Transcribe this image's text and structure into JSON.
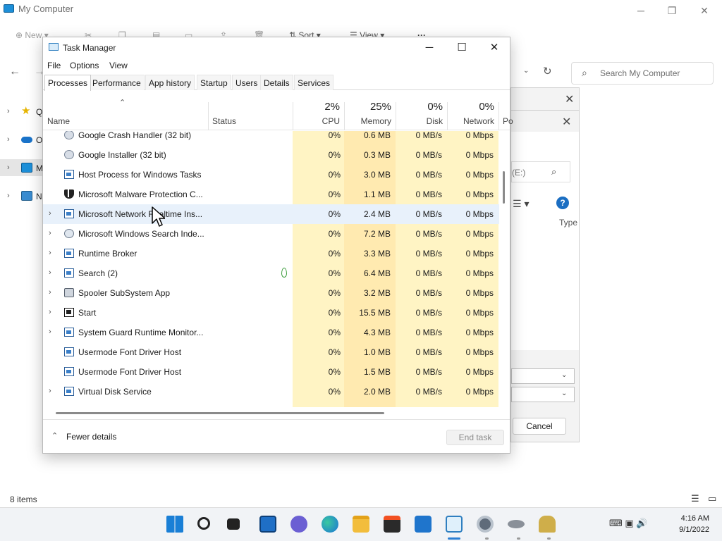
{
  "explorer": {
    "title": "My Computer",
    "toolbar": {
      "new": "New",
      "sort": "Sort",
      "view": "View",
      "more": "···"
    },
    "search_placeholder": "Search My Computer",
    "sidebar": [
      {
        "label": "Q",
        "icon": "star-icon"
      },
      {
        "label": "O",
        "icon": "cloud-icon"
      },
      {
        "label": "M",
        "icon": "monitor-icon"
      },
      {
        "label": "N",
        "icon": "network-icon"
      }
    ],
    "status": "8 items"
  },
  "dialog": {
    "path_text": "(E:)",
    "column_type": "Type",
    "cancel": "Cancel"
  },
  "taskmgr": {
    "title": "Task Manager",
    "menu": [
      "File",
      "Options",
      "View"
    ],
    "tabs": [
      "Processes",
      "Performance",
      "App history",
      "Startup",
      "Users",
      "Details",
      "Services"
    ],
    "active_tab": "Processes",
    "columns": {
      "name": "Name",
      "status": "Status",
      "cpu": {
        "pct": "2%",
        "label": "CPU"
      },
      "memory": {
        "pct": "25%",
        "label": "Memory"
      },
      "disk": {
        "pct": "0%",
        "label": "Disk"
      },
      "network": {
        "pct": "0%",
        "label": "Network"
      },
      "power": "Po"
    },
    "rows": [
      {
        "name": "Google Crash Handler (32 bit)",
        "expandable": false,
        "icon": "gear",
        "status": "",
        "cpu": "0%",
        "memory": "0.6 MB",
        "disk": "0 MB/s",
        "network": "0 Mbps"
      },
      {
        "name": "Google Installer (32 bit)",
        "expandable": false,
        "icon": "gear",
        "status": "",
        "cpu": "0%",
        "memory": "0.3 MB",
        "disk": "0 MB/s",
        "network": "0 Mbps"
      },
      {
        "name": "Host Process for Windows Tasks",
        "expandable": false,
        "icon": "win",
        "status": "",
        "cpu": "0%",
        "memory": "3.0 MB",
        "disk": "0 MB/s",
        "network": "0 Mbps"
      },
      {
        "name": "Microsoft Malware Protection C...",
        "expandable": false,
        "icon": "shield",
        "status": "",
        "cpu": "0%",
        "memory": "1.1 MB",
        "disk": "0 MB/s",
        "network": "0 Mbps"
      },
      {
        "name": "Microsoft Network Realtime Ins...",
        "expandable": true,
        "icon": "win",
        "status": "",
        "cpu": "0%",
        "memory": "2.4 MB",
        "disk": "0 MB/s",
        "network": "0 Mbps",
        "hover": true
      },
      {
        "name": "Microsoft Windows Search Inde...",
        "expandable": true,
        "icon": "person",
        "status": "",
        "cpu": "0%",
        "memory": "7.2 MB",
        "disk": "0 MB/s",
        "network": "0 Mbps"
      },
      {
        "name": "Runtime Broker",
        "expandable": true,
        "icon": "win",
        "status": "",
        "cpu": "0%",
        "memory": "3.3 MB",
        "disk": "0 MB/s",
        "network": "0 Mbps"
      },
      {
        "name": "Search (2)",
        "expandable": true,
        "icon": "win",
        "status": "leaf",
        "cpu": "0%",
        "memory": "6.4 MB",
        "disk": "0 MB/s",
        "network": "0 Mbps"
      },
      {
        "name": "Spooler SubSystem App",
        "expandable": true,
        "icon": "printer",
        "status": "",
        "cpu": "0%",
        "memory": "3.2 MB",
        "disk": "0 MB/s",
        "network": "0 Mbps"
      },
      {
        "name": "Start",
        "expandable": true,
        "icon": "start",
        "status": "",
        "cpu": "0%",
        "memory": "15.5 MB",
        "disk": "0 MB/s",
        "network": "0 Mbps"
      },
      {
        "name": "System Guard Runtime Monitor...",
        "expandable": true,
        "icon": "win",
        "status": "",
        "cpu": "0%",
        "memory": "4.3 MB",
        "disk": "0 MB/s",
        "network": "0 Mbps"
      },
      {
        "name": "Usermode Font Driver Host",
        "expandable": false,
        "icon": "win",
        "status": "",
        "cpu": "0%",
        "memory": "1.0 MB",
        "disk": "0 MB/s",
        "network": "0 Mbps"
      },
      {
        "name": "Usermode Font Driver Host",
        "expandable": false,
        "icon": "win",
        "status": "",
        "cpu": "0%",
        "memory": "1.5 MB",
        "disk": "0 MB/s",
        "network": "0 Mbps"
      },
      {
        "name": "Virtual Disk Service",
        "expandable": true,
        "icon": "win",
        "status": "",
        "cpu": "0%",
        "memory": "2.0 MB",
        "disk": "0 MB/s",
        "network": "0 Mbps"
      }
    ],
    "footer": {
      "fewer_details": "Fewer details",
      "end_task": "End task"
    }
  },
  "taskbar": {
    "icons": [
      "windows-start-icon",
      "search-icon",
      "task-view-icon",
      "widgets-icon",
      "chat-icon",
      "edge-icon",
      "file-explorer-icon",
      "store-icon",
      "mail-icon",
      "task-manager-icon",
      "settings-icon",
      "mouse-icon",
      "accessibility-icon"
    ],
    "clock_time": "4:16 AM",
    "clock_date": "9/1/2022"
  },
  "colors": {
    "accent": "#2b7fd4",
    "cpu_column": "#fff4c4",
    "memory_column": "#ffeab0",
    "hover_row": "#e8f1fb"
  }
}
